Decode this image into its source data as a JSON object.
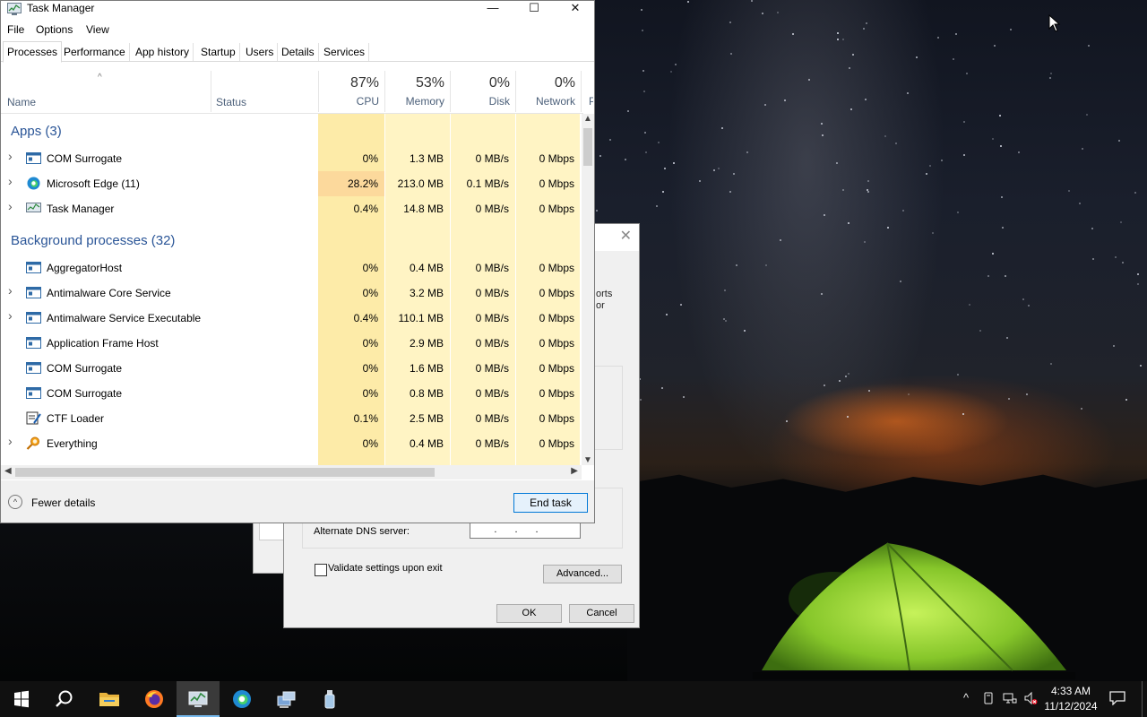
{
  "colors": {
    "heat_light": "#fff4c4",
    "heat_mid": "#fdeba8",
    "heat_hot": "#fcd99c",
    "group_header": "#2a5597",
    "accent": "#0078d7"
  },
  "taskmgr": {
    "title": "Task Manager",
    "caption": {
      "minimize": "—",
      "maximize": "☐",
      "close": "✕"
    },
    "menu": [
      "File",
      "Options",
      "View"
    ],
    "tabs": [
      "Processes",
      "Performance",
      "App history",
      "Startup",
      "Users",
      "Details",
      "Services"
    ],
    "active_tab": "Processes",
    "columns": {
      "name": "Name",
      "status": "Status",
      "cpu": {
        "pct": "87%",
        "label": "CPU"
      },
      "memory": {
        "pct": "53%",
        "label": "Memory"
      },
      "disk": {
        "pct": "0%",
        "label": "Disk"
      },
      "network": {
        "pct": "0%",
        "label": "Network"
      },
      "power": {
        "label": "P"
      }
    },
    "groups": {
      "apps": "Apps (3)",
      "background": "Background processes (32)"
    },
    "apps": [
      {
        "name": "COM Surrogate",
        "cpu": "0%",
        "memory": "1.3 MB",
        "disk": "0 MB/s",
        "network": "0 Mbps",
        "icon": "window-icon",
        "expandable": true
      },
      {
        "name": "Microsoft Edge (11)",
        "cpu": "28.2%",
        "memory": "213.0 MB",
        "disk": "0.1 MB/s",
        "network": "0 Mbps",
        "icon": "edge-icon",
        "expandable": true
      },
      {
        "name": "Task Manager",
        "cpu": "0.4%",
        "memory": "14.8 MB",
        "disk": "0 MB/s",
        "network": "0 Mbps",
        "icon": "task-manager-icon",
        "expandable": true
      }
    ],
    "background": [
      {
        "name": "AggregatorHost",
        "cpu": "0%",
        "memory": "0.4 MB",
        "disk": "0 MB/s",
        "network": "0 Mbps",
        "icon": "window-icon",
        "expandable": false
      },
      {
        "name": "Antimalware Core Service",
        "cpu": "0%",
        "memory": "3.2 MB",
        "disk": "0 MB/s",
        "network": "0 Mbps",
        "icon": "window-icon",
        "expandable": true
      },
      {
        "name": "Antimalware Service Executable",
        "cpu": "0.4%",
        "memory": "110.1 MB",
        "disk": "0 MB/s",
        "network": "0 Mbps",
        "icon": "window-icon",
        "expandable": true
      },
      {
        "name": "Application Frame Host",
        "cpu": "0%",
        "memory": "2.9 MB",
        "disk": "0 MB/s",
        "network": "0 Mbps",
        "icon": "window-icon",
        "expandable": false
      },
      {
        "name": "COM Surrogate",
        "cpu": "0%",
        "memory": "1.6 MB",
        "disk": "0 MB/s",
        "network": "0 Mbps",
        "icon": "window-icon",
        "expandable": false
      },
      {
        "name": "COM Surrogate",
        "cpu": "0%",
        "memory": "0.8 MB",
        "disk": "0 MB/s",
        "network": "0 Mbps",
        "icon": "window-icon",
        "expandable": false
      },
      {
        "name": "CTF Loader",
        "cpu": "0.1%",
        "memory": "2.5 MB",
        "disk": "0 MB/s",
        "network": "0 Mbps",
        "icon": "ctf-loader-icon",
        "expandable": false
      },
      {
        "name": "Everything",
        "cpu": "0%",
        "memory": "0.4 MB",
        "disk": "0 MB/s",
        "network": "0 Mbps",
        "icon": "everything-search-icon",
        "expandable": true
      }
    ],
    "footer": {
      "fewer_details": "Fewer details",
      "end_task": "End task"
    }
  },
  "network_dialog": {
    "close": "✕",
    "partial_text_line1": "orts",
    "partial_text_line2": "or",
    "alternate_dns_label": "Alternate DNS server:",
    "alternate_dns_value": "...",
    "validate_label": "Validate settings upon exit",
    "advanced": "Advanced...",
    "ok": "OK",
    "cancel": "Cancel"
  },
  "taskbar": {
    "items": [
      "start-icon",
      "search-icon",
      "file-explorer-icon",
      "firefox-icon",
      "task-manager-icon",
      "edge-icon",
      "network-settings-icon",
      "usb-drive-icon"
    ],
    "active_item": "task-manager-icon",
    "clock_time": "4:33 AM",
    "clock_date": "11/12/2024"
  }
}
